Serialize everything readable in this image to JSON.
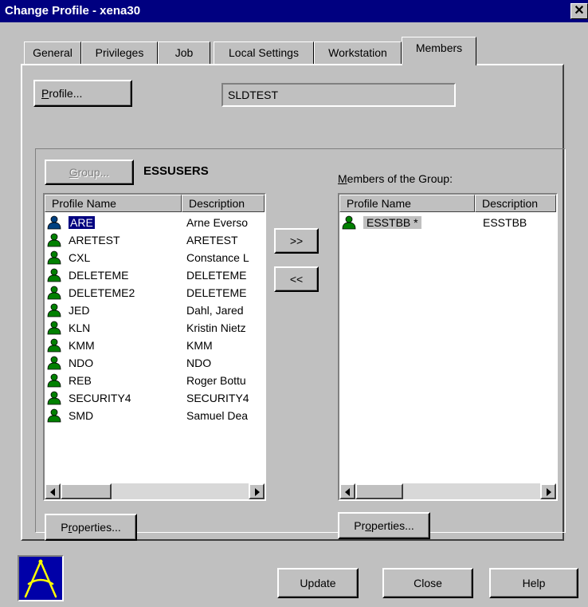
{
  "window": {
    "title": "Change Profile - xena30",
    "close_glyph": "✕"
  },
  "tabs": [
    "General",
    "Privileges",
    "Job",
    "Local Settings",
    "Workstation",
    "Members"
  ],
  "active_tab": "Members",
  "profile": {
    "button_prefix": "",
    "button_u": "P",
    "button_rest": "rofile...",
    "value": "SLDTEST"
  },
  "group": {
    "button_u": "G",
    "button_rest": "roup...",
    "name": "ESSUSERS"
  },
  "members_label": {
    "u": "M",
    "rest": "embers of the Group:"
  },
  "left_list": {
    "columns": [
      "Profile Name",
      "Description"
    ],
    "rows": [
      {
        "name": "ARE",
        "desc": "Arne Everso",
        "selected": true
      },
      {
        "name": "ARETEST",
        "desc": "ARETEST"
      },
      {
        "name": "CXL",
        "desc": "Constance L"
      },
      {
        "name": "DELETEME",
        "desc": "DELETEME"
      },
      {
        "name": "DELETEME2",
        "desc": "DELETEME"
      },
      {
        "name": "JED",
        "desc": "Dahl, Jared"
      },
      {
        "name": "KLN",
        "desc": "Kristin Nietz"
      },
      {
        "name": "KMM",
        "desc": "KMM"
      },
      {
        "name": "NDO",
        "desc": "NDO"
      },
      {
        "name": "REB",
        "desc": "Roger Bottu"
      },
      {
        "name": "SECURITY4",
        "desc": "SECURITY4"
      },
      {
        "name": "SMD",
        "desc": "Samuel Dea"
      }
    ]
  },
  "right_list": {
    "columns": [
      "Profile Name",
      "Description"
    ],
    "rows": [
      {
        "name": "ESSTBB *",
        "desc": "ESSTBB"
      }
    ]
  },
  "transfer": {
    "add": ">>",
    "remove": "<<"
  },
  "properties_left": {
    "pre": "P",
    "u": "r",
    "rest": "operties..."
  },
  "properties_right": {
    "pre": "Pr",
    "u": "o",
    "rest": "perties..."
  },
  "footer": {
    "update": "Update",
    "close": "Close",
    "help": "Help"
  },
  "colors": {
    "title_bar": "#000080",
    "face": "#c0c0c0",
    "selection": "#000080",
    "user_icon": "#008000",
    "logo_bg": "#0000a8",
    "logo_fg": "#ffff00"
  }
}
